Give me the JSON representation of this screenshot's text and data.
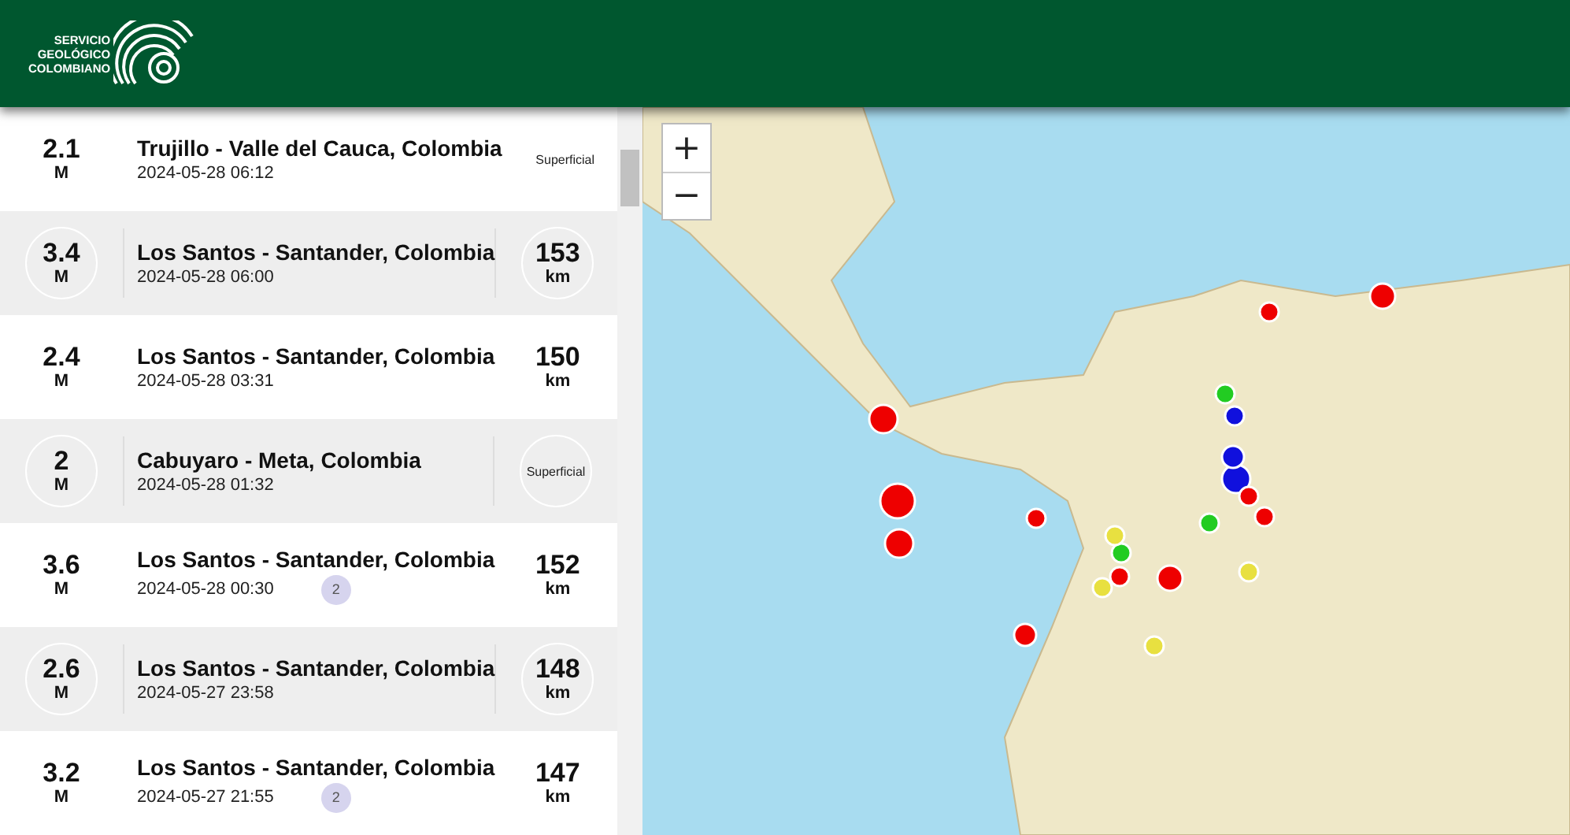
{
  "header": {
    "logo_lines": [
      "SERVICIO",
      "GEOLÓGICO",
      "COLOMBIANO"
    ]
  },
  "events": [
    {
      "magnitude": "2.1",
      "unit": "M",
      "place": "Trujillo - Valle del Cauca, Colombia",
      "time": "2024-05-28 06:12",
      "depth": "Superficial",
      "shaded": false
    },
    {
      "magnitude": "3.4",
      "unit": "M",
      "place": "Los Santos - Santander, Colombia",
      "time": "2024-05-28 06:00",
      "depth": "153",
      "depth_unit": "km",
      "shaded": true
    },
    {
      "magnitude": "2.4",
      "unit": "M",
      "place": "Los Santos - Santander, Colombia",
      "time": "2024-05-28 03:31",
      "depth": "150",
      "depth_unit": "km",
      "shaded": false
    },
    {
      "magnitude": "2",
      "unit": "M",
      "place": "Cabuyaro - Meta, Colombia",
      "time": "2024-05-28 01:32",
      "depth": "Superficial",
      "shaded": true
    },
    {
      "magnitude": "3.6",
      "unit": "M",
      "place": "Los Santos - Santander, Colombia",
      "time": "2024-05-28 00:30",
      "badge": "2",
      "depth": "152",
      "depth_unit": "km",
      "shaded": false
    },
    {
      "magnitude": "2.6",
      "unit": "M",
      "place": "Los Santos - Santander, Colombia",
      "time": "2024-05-27 23:58",
      "depth": "148",
      "depth_unit": "km",
      "shaded": true
    },
    {
      "magnitude": "3.2",
      "unit": "M",
      "place": "Los Santos - Santander, Colombia",
      "time": "2024-05-27 21:55",
      "badge": "2",
      "depth": "147",
      "depth_unit": "km",
      "shaded": false
    }
  ],
  "map": {
    "zoom_in": "+",
    "zoom_out": "−"
  }
}
